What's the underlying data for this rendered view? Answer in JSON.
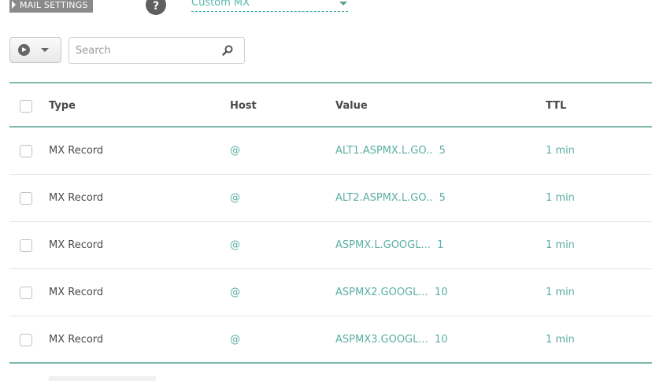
{
  "header": {
    "section_label": "MAIL SETTINGS",
    "help_label": "?",
    "mx_select_value": "Custom MX"
  },
  "toolbar": {
    "search_placeholder": "Search"
  },
  "table": {
    "columns": [
      "Type",
      "Host",
      "Value",
      "TTL"
    ],
    "rows": [
      {
        "type": "MX Record",
        "host": "@",
        "value": "ALT1.ASPMX.L.GO..",
        "priority": "5",
        "ttl": "1 min"
      },
      {
        "type": "MX Record",
        "host": "@",
        "value": "ALT2.ASPMX.L.GO..",
        "priority": "5",
        "ttl": "1 min"
      },
      {
        "type": "MX Record",
        "host": "@",
        "value": "ASPMX.L.GOOGL...",
        "priority": "1",
        "ttl": "1 min"
      },
      {
        "type": "MX Record",
        "host": "@",
        "value": "ASPMX2.GOOGL...",
        "priority": "10",
        "ttl": "1 min"
      },
      {
        "type": "MX Record",
        "host": "@",
        "value": "ASPMX3.GOOGL...",
        "priority": "10",
        "ttl": "1 min"
      }
    ]
  },
  "icons": {
    "action": "play-circle-icon",
    "dropdown": "chevron-down-icon",
    "search": "search-icon"
  },
  "colors": {
    "accent": "#5aaea4",
    "badge": "#8a8a8a",
    "divider": "#7fb8ad"
  }
}
